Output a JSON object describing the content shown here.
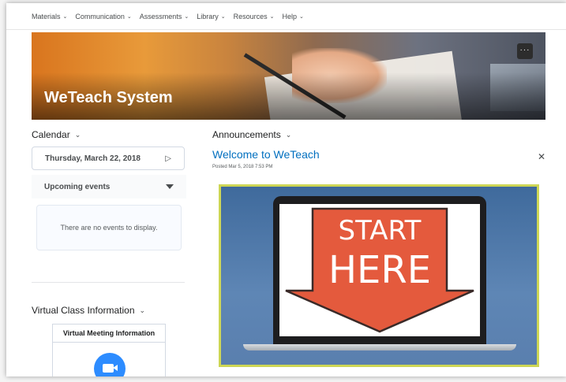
{
  "nav": {
    "items": [
      {
        "label": "Materials"
      },
      {
        "label": "Communication"
      },
      {
        "label": "Assessments"
      },
      {
        "label": "Library"
      },
      {
        "label": "Resources"
      },
      {
        "label": "Help"
      }
    ]
  },
  "banner": {
    "title": "WeTeach System",
    "more_label": "···"
  },
  "calendar": {
    "heading": "Calendar",
    "date": "Thursday, March 22, 2018",
    "upcoming_label": "Upcoming events",
    "empty_text": "There are no events to display."
  },
  "virtual_class": {
    "heading": "Virtual Class Information",
    "box_title": "Virtual Meeting Information"
  },
  "announcements": {
    "heading": "Announcements",
    "title": "Welcome to WeTeach",
    "posted": "Posted Mar 5, 2018 7:53 PM",
    "image_text_line1": "START",
    "image_text_line2": "HERE"
  },
  "icons": {
    "chevron": "chevron-down-icon",
    "next": "play-next-icon",
    "dropdown": "triangle-down-icon",
    "close": "close-icon",
    "zoom": "zoom-video-icon",
    "more": "more-icon"
  },
  "colors": {
    "link": "#006fbf",
    "zoom_blue": "#2d8cff",
    "arrow_red": "#e45a3d",
    "image_border": "#cdd655"
  }
}
